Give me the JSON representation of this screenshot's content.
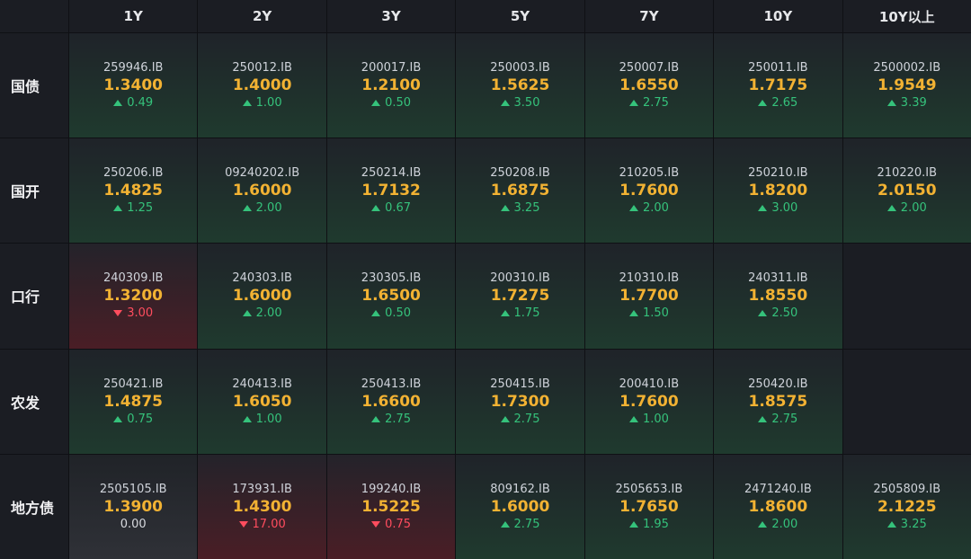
{
  "columns": [
    "1Y",
    "2Y",
    "3Y",
    "5Y",
    "7Y",
    "10Y",
    "10Y以上"
  ],
  "rows": [
    {
      "label": "国债",
      "cells": [
        {
          "code": "259946.IB",
          "yield": "1.3400",
          "change": "0.49",
          "dir": "up"
        },
        {
          "code": "250012.IB",
          "yield": "1.4000",
          "change": "1.00",
          "dir": "up"
        },
        {
          "code": "200017.IB",
          "yield": "1.2100",
          "change": "0.50",
          "dir": "up"
        },
        {
          "code": "250003.IB",
          "yield": "1.5625",
          "change": "3.50",
          "dir": "up"
        },
        {
          "code": "250007.IB",
          "yield": "1.6550",
          "change": "2.75",
          "dir": "up"
        },
        {
          "code": "250011.IB",
          "yield": "1.7175",
          "change": "2.65",
          "dir": "up"
        },
        {
          "code": "2500002.IB",
          "yield": "1.9549",
          "change": "3.39",
          "dir": "up"
        }
      ]
    },
    {
      "label": "国开",
      "cells": [
        {
          "code": "250206.IB",
          "yield": "1.4825",
          "change": "1.25",
          "dir": "up"
        },
        {
          "code": "09240202.IB",
          "yield": "1.6000",
          "change": "2.00",
          "dir": "up"
        },
        {
          "code": "250214.IB",
          "yield": "1.7132",
          "change": "0.67",
          "dir": "up"
        },
        {
          "code": "250208.IB",
          "yield": "1.6875",
          "change": "3.25",
          "dir": "up"
        },
        {
          "code": "210205.IB",
          "yield": "1.7600",
          "change": "2.00",
          "dir": "up"
        },
        {
          "code": "250210.IB",
          "yield": "1.8200",
          "change": "3.00",
          "dir": "up"
        },
        {
          "code": "210220.IB",
          "yield": "2.0150",
          "change": "2.00",
          "dir": "up"
        }
      ]
    },
    {
      "label": "口行",
      "cells": [
        {
          "code": "240309.IB",
          "yield": "1.3200",
          "change": "3.00",
          "dir": "down"
        },
        {
          "code": "240303.IB",
          "yield": "1.6000",
          "change": "2.00",
          "dir": "up"
        },
        {
          "code": "230305.IB",
          "yield": "1.6500",
          "change": "0.50",
          "dir": "up"
        },
        {
          "code": "200310.IB",
          "yield": "1.7275",
          "change": "1.75",
          "dir": "up"
        },
        {
          "code": "210310.IB",
          "yield": "1.7700",
          "change": "1.50",
          "dir": "up"
        },
        {
          "code": "240311.IB",
          "yield": "1.8550",
          "change": "2.50",
          "dir": "up"
        },
        null
      ]
    },
    {
      "label": "农发",
      "cells": [
        {
          "code": "250421.IB",
          "yield": "1.4875",
          "change": "0.75",
          "dir": "up"
        },
        {
          "code": "240413.IB",
          "yield": "1.6050",
          "change": "1.00",
          "dir": "up"
        },
        {
          "code": "250413.IB",
          "yield": "1.6600",
          "change": "2.75",
          "dir": "up"
        },
        {
          "code": "250415.IB",
          "yield": "1.7300",
          "change": "2.75",
          "dir": "up"
        },
        {
          "code": "200410.IB",
          "yield": "1.7600",
          "change": "1.00",
          "dir": "up"
        },
        {
          "code": "250420.IB",
          "yield": "1.8575",
          "change": "2.75",
          "dir": "up"
        },
        null
      ]
    },
    {
      "label": "地方债",
      "cells": [
        {
          "code": "2505105.IB",
          "yield": "1.3900",
          "change": "0.00",
          "dir": "flat"
        },
        {
          "code": "173931.IB",
          "yield": "1.4300",
          "change": "17.00",
          "dir": "down"
        },
        {
          "code": "199240.IB",
          "yield": "1.5225",
          "change": "0.75",
          "dir": "down"
        },
        {
          "code": "809162.IB",
          "yield": "1.6000",
          "change": "2.75",
          "dir": "up"
        },
        {
          "code": "2505653.IB",
          "yield": "1.7650",
          "change": "1.95",
          "dir": "up"
        },
        {
          "code": "2471240.IB",
          "yield": "1.8600",
          "change": "2.00",
          "dir": "up"
        },
        {
          "code": "2505809.IB",
          "yield": "2.1225",
          "change": "3.25",
          "dir": "up"
        }
      ]
    }
  ]
}
